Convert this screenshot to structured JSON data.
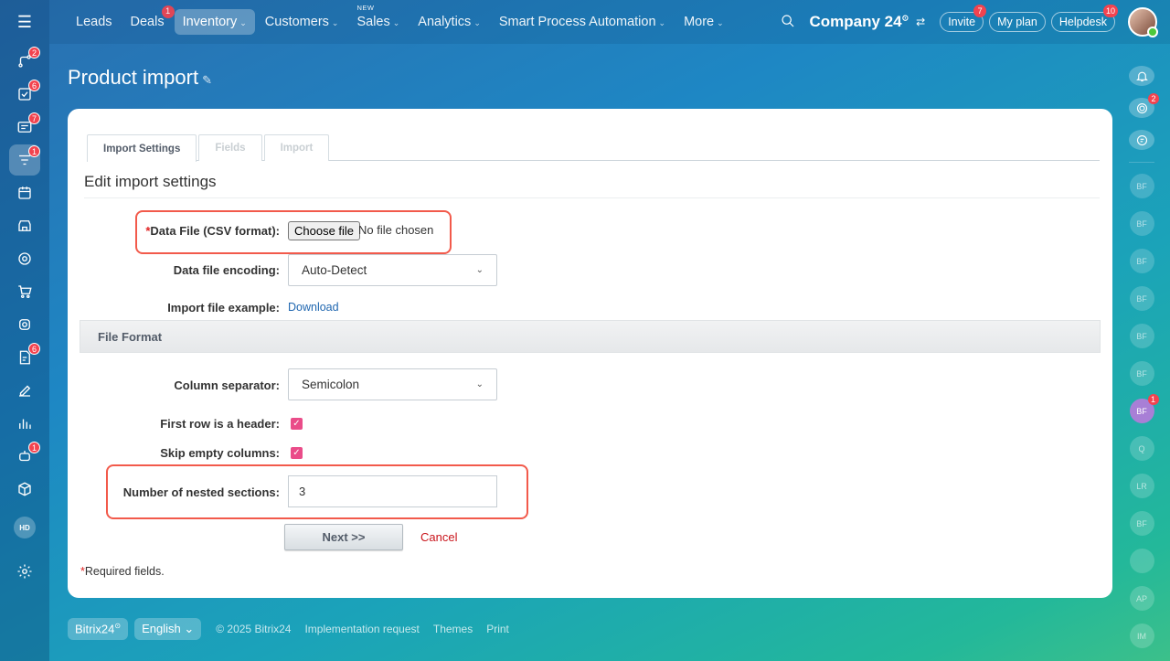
{
  "nav": {
    "items": [
      {
        "label": "Leads",
        "badge": "",
        "new": "",
        "caret": ""
      },
      {
        "label": "Deals",
        "badge": "1",
        "new": "",
        "caret": ""
      },
      {
        "label": "Inventory",
        "badge": "",
        "new": "",
        "caret": "⌄"
      },
      {
        "label": "Customers",
        "badge": "",
        "new": "",
        "caret": "⌄"
      },
      {
        "label": "Sales",
        "badge": "",
        "new": "NEW",
        "caret": "⌄"
      },
      {
        "label": "Analytics",
        "badge": "",
        "new": "",
        "caret": "⌄"
      },
      {
        "label": "Smart Process Automation",
        "badge": "",
        "new": "",
        "caret": "⌄"
      },
      {
        "label": "More",
        "badge": "",
        "new": "",
        "caret": "⌄"
      }
    ],
    "active_index": 2,
    "company": "Company 24",
    "invite": {
      "label": "Invite",
      "badge": "7"
    },
    "my_plan": "My plan",
    "helpdesk": {
      "label": "Helpdesk",
      "badge": "10"
    }
  },
  "left_sidebar": {
    "items": [
      {
        "icon": "activity-stream-icon",
        "badge": "2"
      },
      {
        "icon": "tasks-icon",
        "badge": "6"
      },
      {
        "icon": "messenger-icon",
        "badge": "7"
      },
      {
        "icon": "crm-funnel-icon",
        "badge": "1"
      },
      {
        "icon": "calendar-icon",
        "badge": ""
      },
      {
        "icon": "store-icon",
        "badge": ""
      },
      {
        "icon": "target-icon",
        "badge": ""
      },
      {
        "icon": "cart-icon",
        "badge": ""
      },
      {
        "icon": "bank-icon",
        "badge": ""
      },
      {
        "icon": "document-icon",
        "badge": "6"
      },
      {
        "icon": "sign-icon",
        "badge": ""
      },
      {
        "icon": "analytics-icon",
        "badge": ""
      },
      {
        "icon": "robot-icon",
        "badge": "1"
      },
      {
        "icon": "box-icon",
        "badge": ""
      }
    ],
    "user_initials": "HD"
  },
  "right_sidebar": {
    "users": [
      "BF",
      "BF",
      "BF",
      "BF",
      "BF",
      "BF",
      "BF",
      "Q",
      "LR",
      "BF",
      "",
      "AP",
      "IM"
    ],
    "highlight_index": 6,
    "highlight_badge": "1",
    "copilot_badge": "2"
  },
  "page": {
    "title": "Product import"
  },
  "tabs": [
    "Import Settings",
    "Fields",
    "Import"
  ],
  "form": {
    "section_title": "Edit import settings",
    "data_file_label": "Data File (CSV format):",
    "choose_file": "Choose file",
    "no_file": "No file chosen",
    "encoding_label": "Data file encoding:",
    "encoding_value": "Auto-Detect",
    "example_label": "Import file example:",
    "example_link": "Download",
    "file_format": "File Format",
    "separator_label": "Column separator:",
    "separator_value": "Semicolon",
    "header_label": "First row is a header:",
    "skip_label": "Skip empty columns:",
    "nested_label": "Number of nested sections:",
    "nested_value": "3",
    "next": "Next >>",
    "cancel": "Cancel",
    "required_note": "Required fields.",
    "required_star": "*"
  },
  "footer": {
    "brand": "Bitrix24",
    "language": "English",
    "copyright": "© 2025 Bitrix24",
    "links": [
      "Implementation request",
      "Themes",
      "Print"
    ]
  },
  "colors": {
    "accent_red": "#f25a4b",
    "checkbox": "#ea4c89",
    "link": "#2067b0",
    "cancel": "#c9141b"
  }
}
